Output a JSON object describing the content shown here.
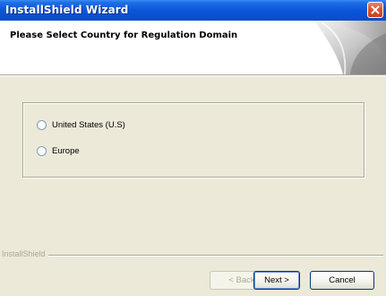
{
  "window": {
    "title": "InstallShield Wizard"
  },
  "header": {
    "title": "Please Select Country for Regulation Domain"
  },
  "options": [
    {
      "label": "United States (U.S)",
      "selected": false
    },
    {
      "label": "Europe",
      "selected": false
    }
  ],
  "footer": {
    "brand": "InstallShield",
    "back_label": "< Back",
    "next_label": "Next >",
    "cancel_label": "Cancel"
  },
  "colors": {
    "titlebar": "#0a56d8",
    "dialog_bg": "#ece9d8",
    "close_button": "#d9532c"
  },
  "icons": {
    "close": "close-icon",
    "header_graphic": "installshield-banner-graphic"
  }
}
